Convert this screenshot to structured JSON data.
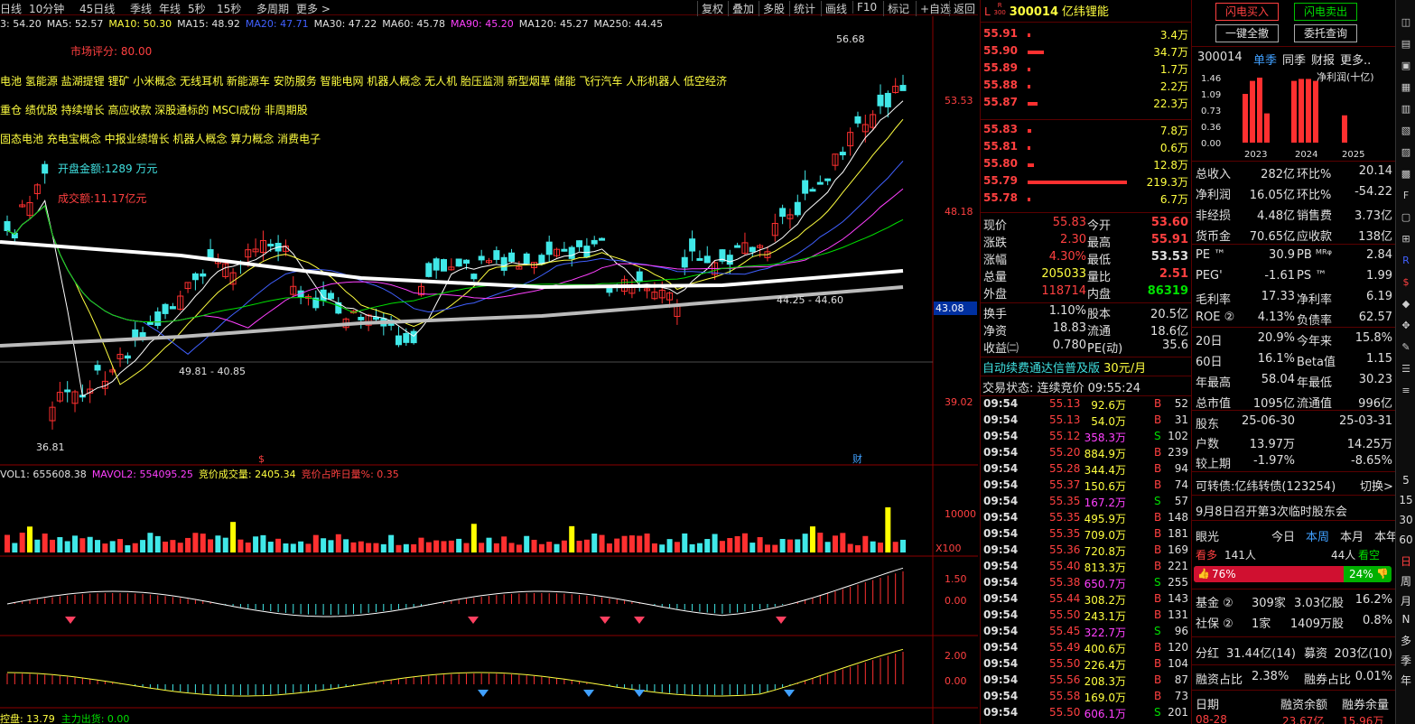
{
  "toolbar": {
    "left_items": [
      "日线",
      "10分钟",
      "45日线",
      "季线",
      "年线",
      "5秒",
      "15秒",
      "多周期",
      "更多 >"
    ],
    "right_items": [
      "复权",
      "叠加",
      "多股",
      "统计",
      "画线",
      "F10",
      "标记",
      "+自选",
      "返回"
    ]
  },
  "ma_line": {
    "items": [
      {
        "text": "3: 54.20",
        "color": "#e0e0e0"
      },
      {
        "text": "MA5: 52.57",
        "color": "#e0e0e0"
      },
      {
        "text": "MA10: 50.30",
        "color": "#ffff40"
      },
      {
        "text": "MA15: 48.92",
        "color": "#e0e0e0"
      },
      {
        "text": "MA20: 47.71",
        "color": "#4060ff"
      },
      {
        "text": "MA30: 47.22",
        "color": "#e0e0e0"
      },
      {
        "text": "MA60: 45.78",
        "color": "#e0e0e0"
      },
      {
        "text": "MA90: 45.20",
        "color": "#ff40ff"
      },
      {
        "text": "MA120: 45.27",
        "color": "#e0e0e0"
      },
      {
        "text": "MA250: 44.45",
        "color": "#e0e0e0"
      }
    ]
  },
  "overlay": {
    "score": "市场评分:  80.00",
    "concepts1": "电池 氢能源 盐湖提锂 锂矿 小米概念 无线耳机 新能源车 安防服务 智能电网 机器人概念 无人机 胎压监测 新型烟草 储能 飞行汽车 人形机器人 低空经济",
    "concepts2": "重仓 绩优股 持续增长 高应收款 深股通标的 MSCI成份 非周期股",
    "concepts3": "固态电池 充电宝概念 中报业绩增长 机器人概念 算力概念 消费电子",
    "open_amount": "开盘金额:1289 万元",
    "turnover": "成交额:11.17亿元",
    "high_label": "56.68",
    "low_label": "36.81",
    "mark1": "49.81 - 40.85",
    "mark2": "44.25 - 44.60",
    "price_axis": [
      "53.53",
      "48.18",
      "43.08",
      "39.02"
    ],
    "s_mark": "$",
    "cai_mark": "财"
  },
  "volume": {
    "header": [
      {
        "text": "VOL1: 655608.38",
        "color": "#e0e0e0"
      },
      {
        "text": "MAVOL2: 554095.25",
        "color": "#ff40ff"
      },
      {
        "text": "竞价成交量: 2405.34",
        "color": "#ffff40"
      },
      {
        "text": "竞价占昨日量%: 0.35",
        "color": "#ff4040"
      }
    ],
    "axis": "10000",
    "unit": "X100"
  },
  "macd": {
    "axis": [
      "1.50",
      "0.00"
    ]
  },
  "kdj": {
    "axis": [
      "2.00",
      "0.00"
    ]
  },
  "bottom_ind": {
    "text1": "控盘: 13.79",
    "text2": "主力出货: 0.00"
  },
  "stock": {
    "badge_top": "R",
    "badge_bottom": "300",
    "code": "300014",
    "name": "亿纬锂能",
    "prefix": "L"
  },
  "asks": [
    {
      "price": "55.91",
      "vol": "3.4万",
      "bar": 0.02
    },
    {
      "price": "55.90",
      "vol": "34.7万",
      "bar": 0.16
    },
    {
      "price": "55.89",
      "vol": "1.7万",
      "bar": 0.01
    },
    {
      "price": "55.88",
      "vol": "2.2万",
      "bar": 0.01
    },
    {
      "price": "55.87",
      "vol": "22.3万",
      "bar": 0.1
    }
  ],
  "bids": [
    {
      "price": "55.83",
      "vol": "7.8万",
      "bar": 0.04
    },
    {
      "price": "55.81",
      "vol": "0.6万",
      "bar": 0.01
    },
    {
      "price": "55.80",
      "vol": "12.8万",
      "bar": 0.06
    },
    {
      "price": "55.79",
      "vol": "219.3万",
      "bar": 1.0
    },
    {
      "price": "55.78",
      "vol": "6.7万",
      "bar": 0.03
    }
  ],
  "quote": [
    {
      "l": "现价",
      "v": "55.83",
      "vc": "red",
      "l2": "今开",
      "v2": "53.60",
      "v2c": "red"
    },
    {
      "l": "涨跌",
      "v": "2.30",
      "vc": "red",
      "l2": "最高",
      "v2": "55.91",
      "v2c": "red"
    },
    {
      "l": "涨幅",
      "v": "4.30%",
      "vc": "red",
      "l2": "最低",
      "v2": "53.53",
      "v2c": "wht"
    },
    {
      "l": "总量",
      "v": "205033",
      "vc": "yel",
      "l2": "量比",
      "v2": "2.51",
      "v2c": "red"
    },
    {
      "l": "外盘",
      "v": "118714",
      "vc": "red",
      "l2": "内盘",
      "v2": "86319",
      "v2c": "grn"
    }
  ],
  "quote2": [
    {
      "l": "换手",
      "v": "1.10%",
      "l2": "股本",
      "v2": "20.5亿"
    },
    {
      "l": "净资",
      "v": "18.83",
      "l2": "流通",
      "v2": "18.6亿"
    },
    {
      "l": "收益㈡",
      "v": "0.780",
      "l2": "PE(动)",
      "v2": "35.6"
    }
  ],
  "promo": {
    "text": "自动续费通达信普及版",
    "price": "30元/月"
  },
  "trade_status": "交易状态: 连续竞价 09:55:24",
  "ticks": [
    {
      "t": "09:54",
      "p": "55.13",
      "v": "92.6万",
      "d": "B",
      "n": "52"
    },
    {
      "t": "09:54",
      "p": "55.13",
      "v": "54.0万",
      "d": "B",
      "n": "31"
    },
    {
      "t": "09:54",
      "p": "55.12",
      "v": "358.3万",
      "d": "S",
      "n": "102"
    },
    {
      "t": "09:54",
      "p": "55.20",
      "v": "884.9万",
      "d": "B",
      "n": "239"
    },
    {
      "t": "09:54",
      "p": "55.28",
      "v": "344.4万",
      "d": "B",
      "n": "94"
    },
    {
      "t": "09:54",
      "p": "55.37",
      "v": "150.6万",
      "d": "B",
      "n": "74"
    },
    {
      "t": "09:54",
      "p": "55.35",
      "v": "167.2万",
      "d": "S",
      "n": "57"
    },
    {
      "t": "09:54",
      "p": "55.35",
      "v": "495.9万",
      "d": "B",
      "n": "148"
    },
    {
      "t": "09:54",
      "p": "55.35",
      "v": "709.0万",
      "d": "B",
      "n": "181"
    },
    {
      "t": "09:54",
      "p": "55.36",
      "v": "720.8万",
      "d": "B",
      "n": "169"
    },
    {
      "t": "09:54",
      "p": "55.40",
      "v": "813.3万",
      "d": "B",
      "n": "221"
    },
    {
      "t": "09:54",
      "p": "55.38",
      "v": "650.7万",
      "d": "S",
      "n": "255"
    },
    {
      "t": "09:54",
      "p": "55.44",
      "v": "308.2万",
      "d": "B",
      "n": "143"
    },
    {
      "t": "09:54",
      "p": "55.50",
      "v": "243.1万",
      "d": "B",
      "n": "131"
    },
    {
      "t": "09:54",
      "p": "55.45",
      "v": "322.7万",
      "d": "S",
      "n": "96"
    },
    {
      "t": "09:54",
      "p": "55.49",
      "v": "400.6万",
      "d": "B",
      "n": "120"
    },
    {
      "t": "09:54",
      "p": "55.50",
      "v": "226.4万",
      "d": "B",
      "n": "104"
    },
    {
      "t": "09:54",
      "p": "55.56",
      "v": "208.3万",
      "d": "B",
      "n": "87"
    },
    {
      "t": "09:54",
      "p": "55.58",
      "v": "169.0万",
      "d": "B",
      "n": "73"
    },
    {
      "t": "09:54",
      "p": "55.50",
      "v": "606.1万",
      "d": "S",
      "n": "201"
    }
  ],
  "panel2": {
    "flash_buy": "闪电买入",
    "flash_sell": "闪电卖出",
    "cancel_all": "一键全撤",
    "orders": "委托查询",
    "code": "300014",
    "tabs": [
      "单季",
      "同季",
      "财报",
      "更多.."
    ],
    "chart_title": "净利润(十亿)",
    "chart_y": [
      "1.46",
      "1.09",
      "0.73",
      "0.36",
      "0.00"
    ],
    "chart_x": [
      "2023",
      "2024",
      "2025"
    ],
    "fin": [
      {
        "l": "总收入",
        "v": "282亿",
        "l2": "环比%",
        "v2": "20.14"
      },
      {
        "l": "净利润",
        "v": "16.05亿",
        "l2": "环比%",
        "v2": "-54.22"
      },
      {
        "l": "非经损",
        "v": "4.48亿",
        "l2": "销售费",
        "v2": "3.73亿"
      },
      {
        "l": "货币金",
        "v": "70.65亿",
        "l2": "应收款",
        "v2": "138亿"
      }
    ],
    "val": [
      {
        "l": "PE ™",
        "v": "30.9",
        "l2": "PB ᴹᴿᵠ",
        "v2": "2.84"
      },
      {
        "l": "PEG'",
        "v": "-1.61",
        "l2": "PS ™",
        "v2": "1.99"
      },
      {
        "l": "毛利率",
        "v": "17.33",
        "l2": "净利率",
        "v2": "6.19"
      },
      {
        "l": "ROE ②",
        "v": "4.13%",
        "l2": "负债率",
        "v2": "62.57"
      }
    ],
    "perf": [
      {
        "l": "20日",
        "v": "20.9%",
        "l2": "今年来",
        "v2": "15.8%"
      },
      {
        "l": "60日",
        "v": "16.1%",
        "l2": "Beta值",
        "v2": "1.15"
      },
      {
        "l": "年最高",
        "v": "58.04",
        "l2": "年最低",
        "v2": "30.23"
      },
      {
        "l": "总市值",
        "v": "1095亿",
        "l2": "流通值",
        "v2": "996亿"
      }
    ],
    "holders": [
      {
        "l": "股东",
        "v": "25-06-30",
        "v2": "25-03-31"
      },
      {
        "l": "户数",
        "v": "13.97万",
        "v2": "14.25万"
      },
      {
        "l": "较上期",
        "v": "-1.97%",
        "v2": "-8.65%"
      }
    ],
    "convertible": "可转债:亿纬转债(123254)",
    "switch": "切换>",
    "notice": "9月8日召开第3次临时股东会",
    "eye": "眼光",
    "eye_tabs": [
      "今日",
      "本周",
      "本月",
      "本年"
    ],
    "bull_label": "看多",
    "bull_n": "141人",
    "bear_n": "44人",
    "bear_label": "看空",
    "bull_pct": "76%",
    "bear_pct": "24%",
    "bull_frac": 0.76,
    "fund": [
      {
        "l": "基金 ②",
        "v": "309家",
        "v2": "3.03亿股",
        "v3": "16.2%"
      },
      {
        "l": "社保 ②",
        "v": "1家",
        "v2": "1409万股",
        "v3": "0.8%"
      }
    ],
    "div": {
      "l": "分红",
      "v": "31.44亿(14)",
      "l2": "募资",
      "v2": "203亿(10)"
    },
    "margin": {
      "l": "融资占比",
      "v": "2.38%",
      "l2": "融券占比",
      "v2": "0.01%"
    },
    "mtable": {
      "h1": "日期",
      "h2": "融资余额",
      "h3": "融券余量",
      "d": "08-28",
      "a": "23.67亿",
      "b": "15.96万"
    }
  },
  "sidebar": [
    "5",
    "15",
    "30",
    "60",
    "日",
    "周",
    "月",
    "N",
    "多",
    "季",
    "年"
  ]
}
